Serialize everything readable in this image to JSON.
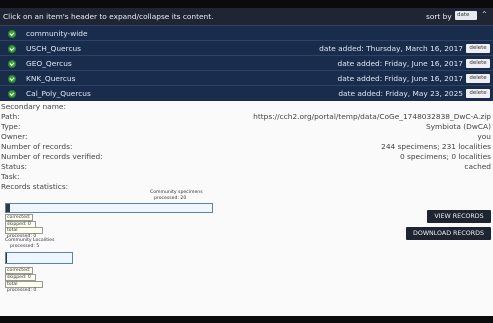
{
  "header": {
    "message": "Click on an item's header to expand/collapse its content.",
    "sort_label": "sort by",
    "sort_value": "date",
    "collapse_icon": "chevron-up-icon"
  },
  "items": [
    {
      "name": "community-wide",
      "date": "",
      "delete": ""
    },
    {
      "name": "USCH_Quercus",
      "date": "date added: Thursday, March 16, 2017",
      "delete": "delete"
    },
    {
      "name": "GEO_Qercus",
      "date": "date added: Friday, June 16, 2017",
      "delete": "delete"
    },
    {
      "name": "KNK_Quercus",
      "date": "date added: Friday, June 16, 2017",
      "delete": "delete"
    },
    {
      "name": "Cal_Poly_Quercus",
      "date": "date added: Friday, May 23, 2025",
      "delete": "delete"
    }
  ],
  "details": {
    "secondary_name": {
      "label": "Secondary name:",
      "value": ""
    },
    "path": {
      "label": "Path:",
      "value": "https://cch2.org/portal/temp/data/CoGe_1748032838_DwC-A.zip"
    },
    "type": {
      "label": "Type:",
      "value": "Symbiota (DwCA)"
    },
    "owner": {
      "label": "Owner:",
      "value": "you"
    },
    "records": {
      "label": "Number of records:",
      "value": "244 specimens; 231 localities"
    },
    "verified": {
      "label": "Number of records verified:",
      "value": "0 specimens; 0 localities"
    },
    "status": {
      "label": "Status:",
      "value": "cached"
    },
    "task": {
      "label": "Task:",
      "value": ""
    },
    "stats": {
      "label": "Records statistics:"
    }
  },
  "specimens": {
    "title_line1": "Community specimens",
    "title_line2": "processed: 20",
    "progress": 0.02,
    "corrected": "corrected: 0",
    "skipped": "skipped: 0",
    "total": "total processed: 0"
  },
  "localities": {
    "title_line1": "Community Localities",
    "title_line2": "processed: 5",
    "progress": 0.02,
    "corrected": "corrected: 0",
    "skipped": "skipped: 0",
    "total": "total processed: 0"
  },
  "buttons": {
    "view": "VIEW RECORDS",
    "download": "DOWNLOAD RECORDS"
  },
  "colors": {
    "item_bar": "#1a2c4c",
    "check_green": "#3ea63e",
    "button_dark": "#1e2430"
  }
}
